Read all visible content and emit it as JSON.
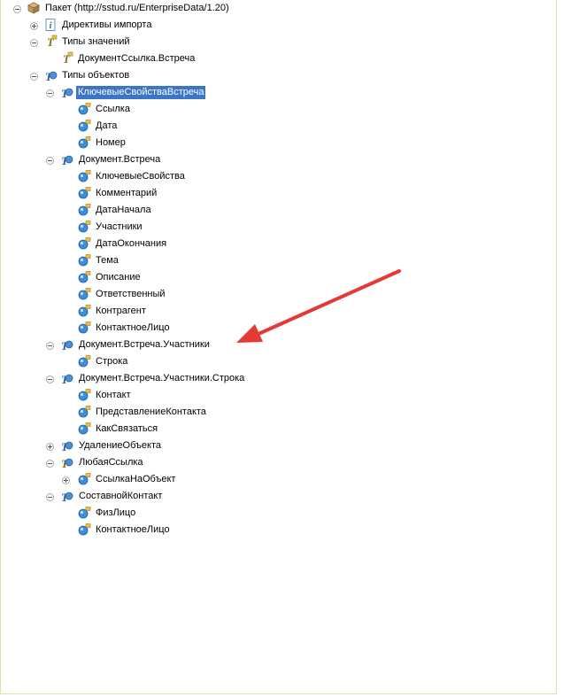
{
  "tree": {
    "root": "Пакет (http://sstud.ru/EnterpriseData/1.20)",
    "import_directives": "Директивы импорта",
    "value_types": "Типы значений",
    "value_type_item": "ДокументСсылка.Встреча",
    "object_types": "Типы объектов",
    "key_props_obj": "КлючевыеСвойстваВстреча",
    "key_props_fields": [
      "Ссылка",
      "Дата",
      "Номер"
    ],
    "doc_obj": "Документ.Встреча",
    "doc_fields": [
      "КлючевыеСвойства",
      "Комментарий",
      "ДатаНачала",
      "Участники",
      "ДатаОкончания",
      "Тема",
      "Описание",
      "Ответственный",
      "Контрагент",
      "КонтактноеЛицо"
    ],
    "participants_obj": "Документ.Встреча.Участники",
    "participants_fields": [
      "Строка"
    ],
    "row_obj": "Документ.Встреча.Участники.Строка",
    "row_fields": [
      "Контакт",
      "ПредставлениеКонтакта",
      "КакСвязаться"
    ],
    "delete_obj": "УдалениеОбъекта",
    "anyref_obj": "ЛюбаяСсылка",
    "anyref_child": "СсылкаНаОбъект",
    "composite_obj": "СоставнойКонтакт",
    "composite_fields": [
      "ФизЛицо",
      "КонтактноеЛицо"
    ]
  },
  "colors": {
    "selection": "#3b74c8",
    "arrow": "#e53935",
    "frame": "#e6e0a8"
  }
}
